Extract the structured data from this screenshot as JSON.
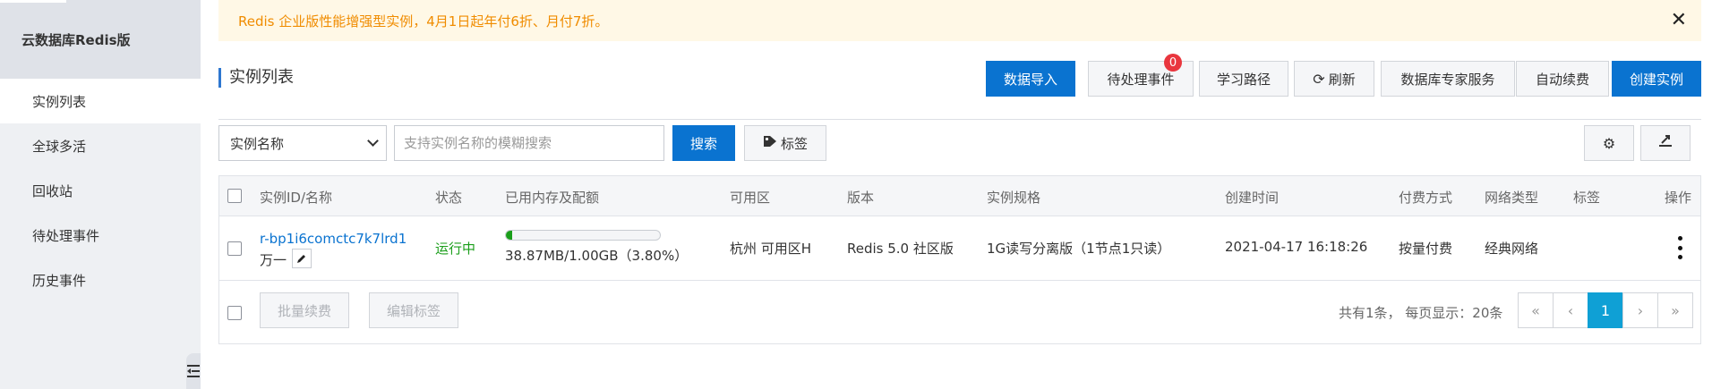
{
  "sidebar": {
    "title": "云数据库Redis版",
    "items": [
      {
        "label": "实例列表",
        "active": true
      },
      {
        "label": "全球多活"
      },
      {
        "label": "回收站"
      },
      {
        "label": "待处理事件"
      },
      {
        "label": "历史事件"
      }
    ],
    "collapse_icon": "menu-collapse-icon"
  },
  "notice": {
    "text": "Redis 企业版性能增强型实例，4月1日起年付6折、月付7折。",
    "close_icon": "close-icon"
  },
  "header": {
    "title": "实例列表",
    "buttons": {
      "import": "数据导入",
      "pending": "待处理事件",
      "pending_count": "0",
      "learn": "学习路径",
      "refresh": "刷新",
      "expert": "数据库专家服务",
      "auto_renew": "自动续费",
      "create": "创建实例"
    }
  },
  "toolbar": {
    "select_value": "实例名称",
    "search_placeholder": "支持实例名称的模糊搜索",
    "search_label": "搜索",
    "tag_label": "标签"
  },
  "table": {
    "columns": [
      "实例ID/名称",
      "状态",
      "已用内存及配额",
      "可用区",
      "版本",
      "实例规格",
      "创建时间",
      "付费方式",
      "网络类型",
      "标签",
      "操作"
    ],
    "rows": [
      {
        "id": "r-bp1i6comctc7k7lrd1",
        "name": "万一",
        "status": "运行中",
        "memory_text": "38.87MB/1.00GB（3.80%）",
        "memory_fraction": 0.038,
        "zone": "杭州 可用区H",
        "version": "Redis 5.0 社区版",
        "spec": "1G读写分离版（1节点1只读）",
        "created": "2021-04-17 16:18:26",
        "billing": "按量付费",
        "network": "经典网络",
        "tags": ""
      }
    ],
    "footer": {
      "batch_renew": "批量续费",
      "edit_tags": "编辑标签",
      "summary": "共有1条，  每页显示：20条",
      "pager": {
        "first": "«",
        "prev": "‹",
        "current": "1",
        "next": "›",
        "last": "»"
      }
    }
  },
  "colors": {
    "primary": "#0a73d0",
    "notice_bg": "#fff8e6",
    "notice_text": "#f08c00",
    "running": "#1a9e1a",
    "badge": "#e9363e",
    "pager_active": "#0fa0d5"
  }
}
